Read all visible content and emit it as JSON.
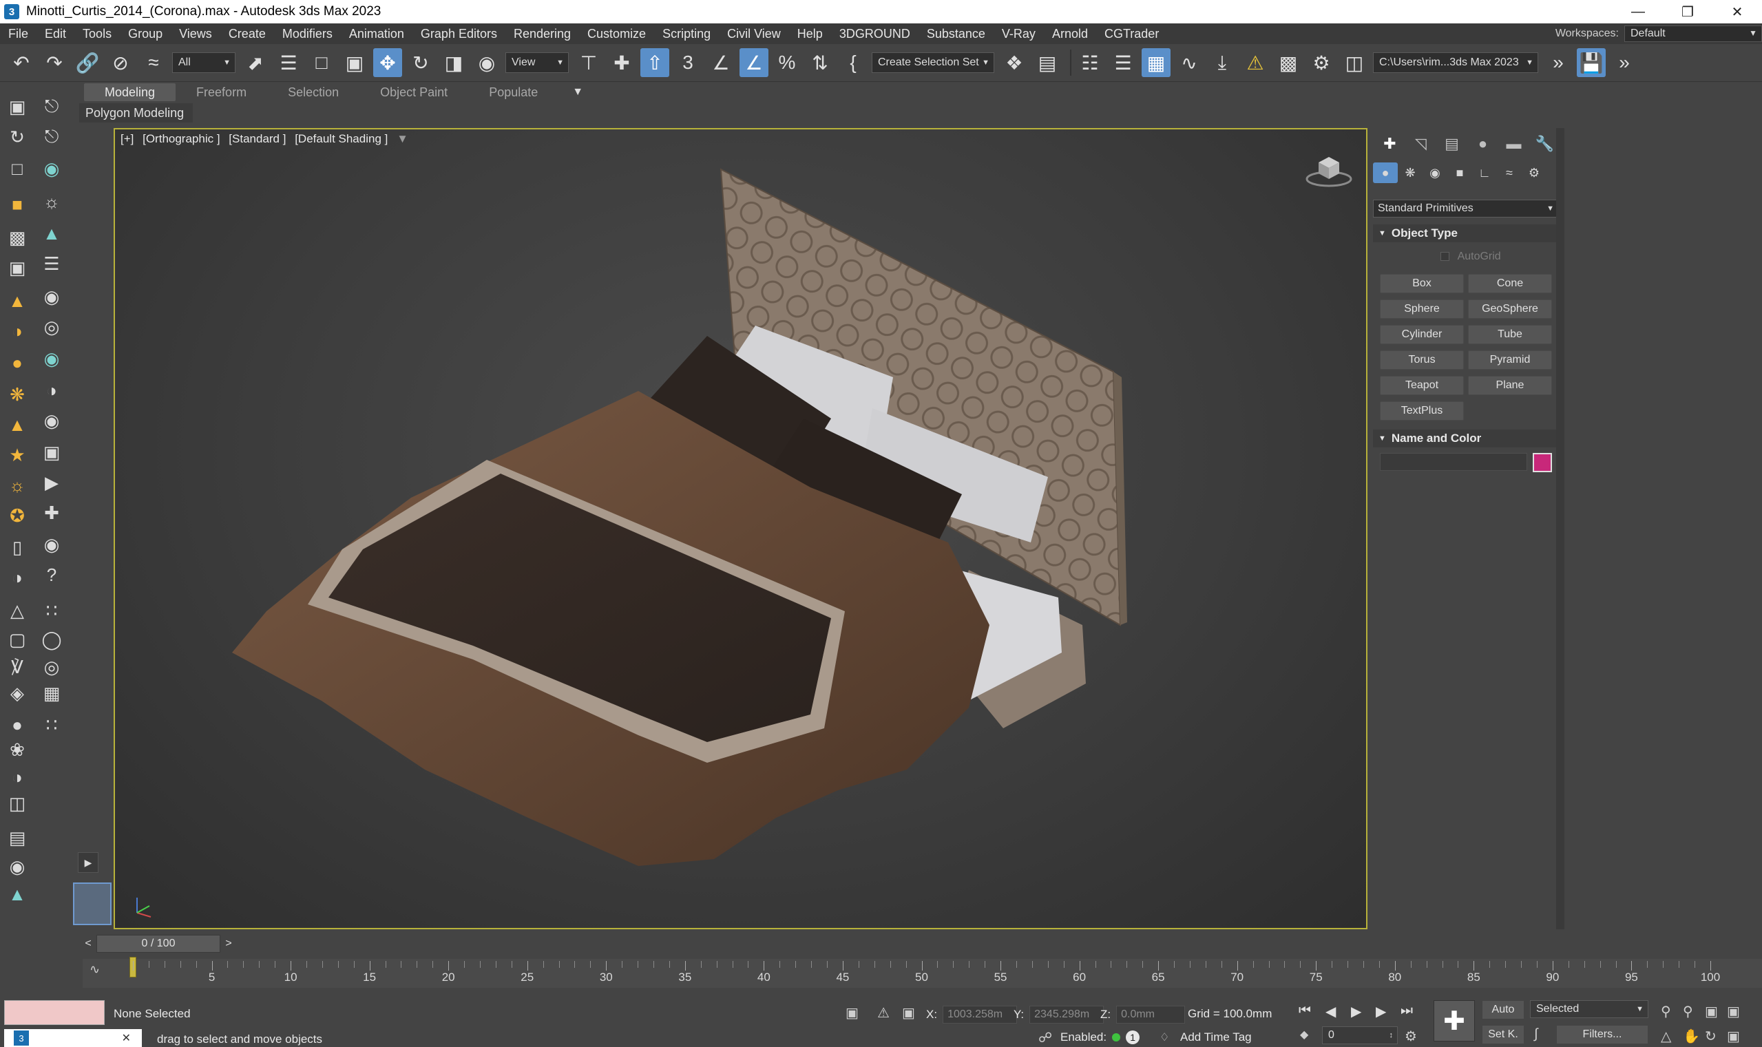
{
  "window": {
    "title": "Minotti_Curtis_2014_(Corona).max - Autodesk 3ds Max 2023",
    "app_icon": "3",
    "controls": [
      "minimize-icon",
      "restore-icon",
      "close-icon"
    ]
  },
  "menu": {
    "items": [
      "File",
      "Edit",
      "Tools",
      "Group",
      "Views",
      "Create",
      "Modifiers",
      "Animation",
      "Graph Editors",
      "Rendering",
      "Customize",
      "Scripting",
      "Civil View",
      "Help",
      "3DGROUND",
      "Substance",
      "V-Ray",
      "Arnold",
      "CGTrader"
    ],
    "workspaces_label": "Workspaces:",
    "workspace_value": "Default"
  },
  "toolbar": {
    "selection_filter": "All",
    "ref_coord": "View",
    "named_selection": "Create Selection Set",
    "project_path": "C:\\Users\\rim...3ds Max 2023",
    "icons": [
      "undo-icon",
      "redo-icon",
      "link-icon",
      "unlink-icon",
      "bind-spacewarp-icon",
      "select-object-icon",
      "select-by-name-icon",
      "rect-region-icon",
      "window-crossing-icon",
      "move-icon",
      "rotate-icon",
      "scale-icon",
      "placement-icon",
      "pivot-icon",
      "select-manipulate-icon",
      "keyboard-shortcut-icon",
      "snap-3d-icon",
      "angle-snap-icon",
      "percent-snap-icon",
      "spinner-snap-icon",
      "edit-named-sets-icon",
      "mirror-icon",
      "align-icon",
      "scene-explorer-icon",
      "layer-explorer-icon",
      "ribbon-toggle-icon",
      "curve-editor-icon",
      "schematic-view-icon",
      "warning-icon",
      "material-editor-icon",
      "render-setup-icon",
      "render-frame-icon",
      "render-icon"
    ]
  },
  "ribbon": {
    "tabs": [
      "Modeling",
      "Freeform",
      "Selection",
      "Object Paint",
      "Populate"
    ],
    "active_tab": "Modeling",
    "panel_label": "Polygon Modeling"
  },
  "viewport": {
    "label_parts": [
      "[+]",
      "[Orthographic ]",
      "[Standard ]",
      "[Default Shading ]"
    ],
    "filter_icon": "filter-icon"
  },
  "command_panel": {
    "tabs": [
      "create-tab-icon",
      "modify-tab-icon",
      "hierarchy-tab-icon",
      "motion-tab-icon",
      "display-tab-icon",
      "utilities-tab-icon"
    ],
    "subtabs": [
      "geometry-icon",
      "shapes-icon",
      "lights-icon",
      "cameras-icon",
      "helpers-icon",
      "spacewarps-icon",
      "systems-icon"
    ],
    "category": "Standard Primitives",
    "object_type_title": "Object Type",
    "autogrid": "AutoGrid",
    "buttons": [
      "Box",
      "Cone",
      "Sphere",
      "GeoSphere",
      "Cylinder",
      "Tube",
      "Torus",
      "Pyramid",
      "Teapot",
      "Plane",
      "TextPlus"
    ],
    "name_color_title": "Name and Color",
    "name_value": "",
    "object_color": "#c8287a"
  },
  "time_slider": {
    "frame": "0 / 100",
    "prev": "<",
    "next": ">"
  },
  "track": {
    "ticks": [
      5,
      10,
      15,
      20,
      25,
      30,
      35,
      40,
      45,
      50,
      55,
      60,
      65,
      70,
      75,
      80,
      85,
      90,
      95,
      100
    ],
    "start": 0,
    "end": 100,
    "current": 0
  },
  "status": {
    "selection": "None Selected",
    "prompt": "drag to select and move objects",
    "x_label": "X:",
    "x_value": "1003.258m",
    "y_label": "Y:",
    "y_value": "2345.298m",
    "z_label": "Z:",
    "z_value": "0.0mm",
    "grid": "Grid = 100.0mm",
    "enabled_label": "Enabled:",
    "enabled_count": "1",
    "add_time_tag": "Add Time Tag",
    "auto_key": "Auto",
    "set_key": "Set K.",
    "key_filter": "Selected",
    "filters": "Filters...",
    "frame_field": "0"
  },
  "colors": {
    "accent": "#5a8fc9",
    "viewport_border": "#b8b23a",
    "background": "#444444"
  }
}
